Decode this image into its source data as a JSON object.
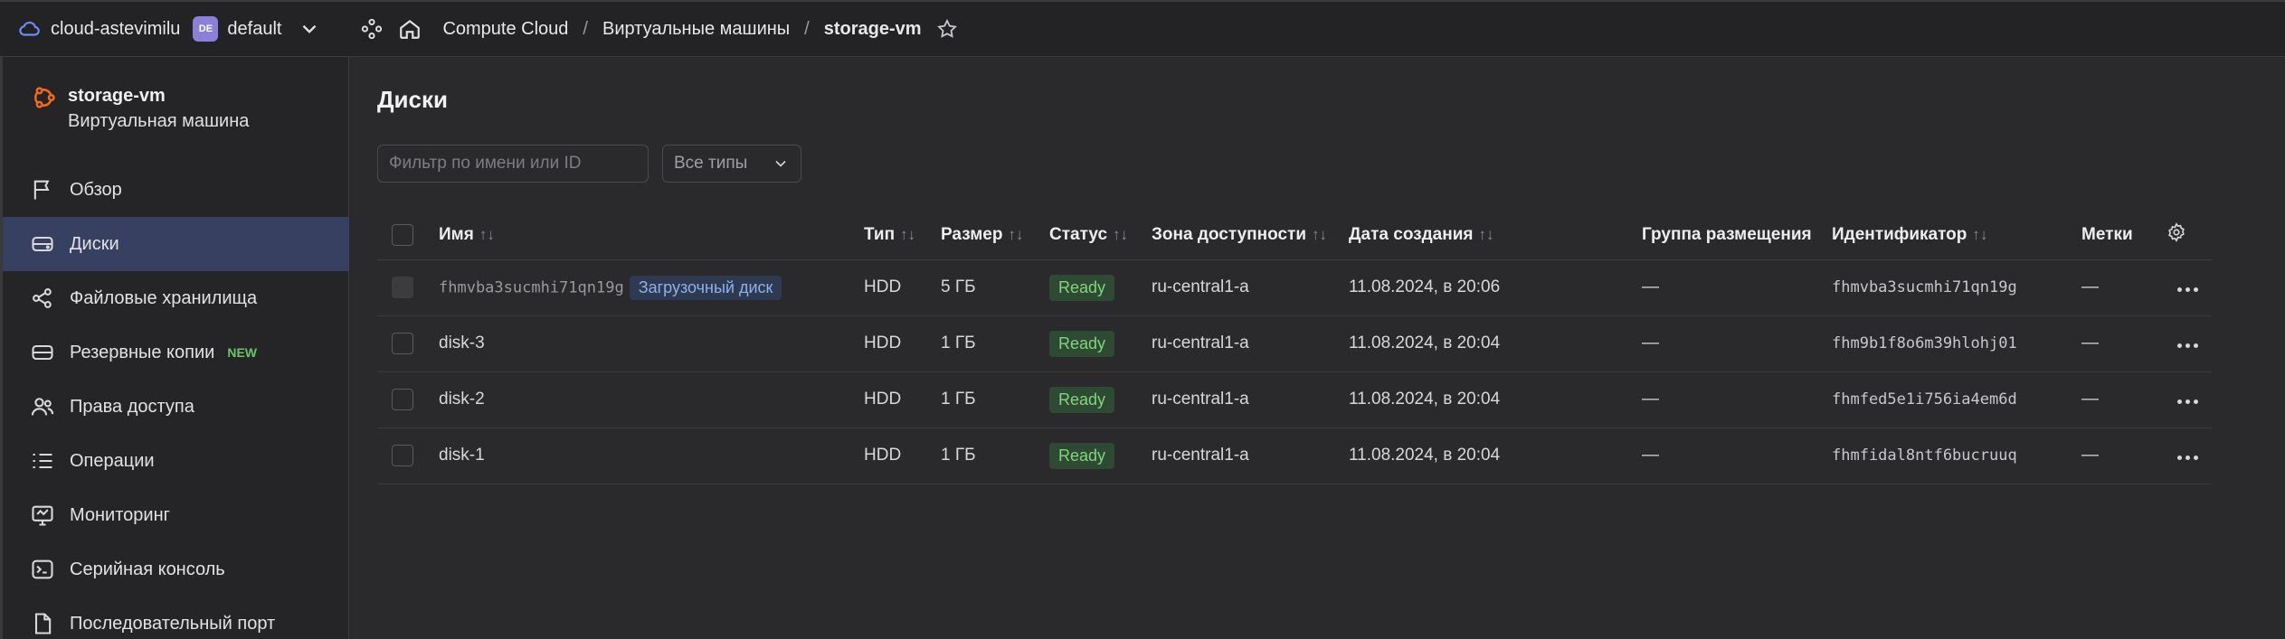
{
  "topbar": {
    "cloud_name": "cloud-astevimilu",
    "folder_badge": "DE",
    "folder_name": "default",
    "breadcrumbs": [
      "Compute Cloud",
      "Виртуальные машины",
      "storage-vm"
    ],
    "separator": "/"
  },
  "sidebar": {
    "vm_name": "storage-vm",
    "vm_type": "Виртуальная машина",
    "items": [
      {
        "label": "Обзор",
        "icon": "flag-icon"
      },
      {
        "label": "Диски",
        "icon": "disk-icon",
        "active": true
      },
      {
        "label": "Файловые хранилища",
        "icon": "share-icon"
      },
      {
        "label": "Резервные копии",
        "icon": "backup-icon",
        "badge": "NEW"
      },
      {
        "label": "Права доступа",
        "icon": "users-icon"
      },
      {
        "label": "Операции",
        "icon": "list-icon"
      },
      {
        "label": "Мониторинг",
        "icon": "monitor-icon"
      },
      {
        "label": "Серийная консоль",
        "icon": "terminal-icon"
      },
      {
        "label": "Последовательный порт",
        "icon": "file-icon"
      }
    ]
  },
  "main": {
    "title": "Диски",
    "filter_placeholder": "Фильтр по имени или ID",
    "type_select": "Все типы",
    "columns": {
      "name": "Имя",
      "type": "Тип",
      "size": "Размер",
      "status": "Статус",
      "zone": "Зона доступности",
      "created": "Дата создания",
      "placement": "Группа размещения",
      "id": "Идентификатор",
      "labels": "Метки"
    },
    "rows": [
      {
        "name": "fhmvba3sucmhi71qn19g",
        "boot_badge": "Загрузочный диск",
        "type": "HDD",
        "size": "5 ГБ",
        "status": "Ready",
        "zone": "ru-central1-a",
        "created": "11.08.2024, в 20:06",
        "placement": "—",
        "id": "fhmvba3sucmhi71qn19g",
        "labels": "—"
      },
      {
        "name": "disk-3",
        "type": "HDD",
        "size": "1 ГБ",
        "status": "Ready",
        "zone": "ru-central1-a",
        "created": "11.08.2024, в 20:04",
        "placement": "—",
        "id": "fhm9b1f8o6m39hlohj01",
        "labels": "—"
      },
      {
        "name": "disk-2",
        "type": "HDD",
        "size": "1 ГБ",
        "status": "Ready",
        "zone": "ru-central1-a",
        "created": "11.08.2024, в 20:04",
        "placement": "—",
        "id": "fhmfed5e1i756ia4em6d",
        "labels": "—"
      },
      {
        "name": "disk-1",
        "type": "HDD",
        "size": "1 ГБ",
        "status": "Ready",
        "zone": "ru-central1-a",
        "created": "11.08.2024, в 20:04",
        "placement": "—",
        "id": "fhmfidal8ntf6bucruuq",
        "labels": "—"
      }
    ]
  },
  "colors": {
    "accent": "#374060",
    "ready_bg": "#2f4a32",
    "ready_text": "#7fd580",
    "brand_orange": "#f26b1d"
  }
}
